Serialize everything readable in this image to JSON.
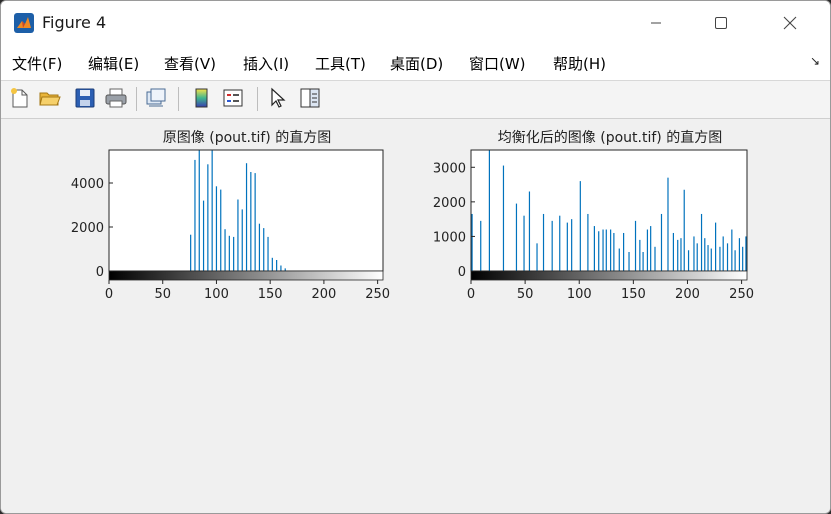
{
  "window": {
    "title": "Figure 4"
  },
  "menu": {
    "items": [
      "文件(F)",
      "编辑(E)",
      "查看(V)",
      "插入(I)",
      "工具(T)",
      "桌面(D)",
      "窗口(W)",
      "帮助(H)"
    ],
    "overflow_icon": "menu-dock-arrow-icon"
  },
  "toolbar": {
    "icons": [
      "new-figure-icon",
      "open-file-icon",
      "save-icon",
      "print-icon",
      "link-plot-icon",
      "insert-colorbar-icon",
      "insert-legend-icon",
      "pointer-icon",
      "property-inspector-icon"
    ]
  },
  "chart_data": [
    {
      "type": "bar",
      "title": "原图像 (pout.tif) 的直方图",
      "xlim": [
        0,
        255
      ],
      "ylim": [
        0,
        5500
      ],
      "xticks": [
        0,
        50,
        100,
        150,
        200,
        250
      ],
      "yticks": [
        0,
        2000,
        4000
      ],
      "xlabel": "",
      "ylabel": "",
      "colorbar": "grayscale",
      "bar_color": "#0072bd",
      "x": [
        76,
        80,
        84,
        88,
        92,
        96,
        100,
        104,
        108,
        112,
        116,
        120,
        124,
        128,
        132,
        136,
        140,
        144,
        148,
        152,
        156,
        160,
        164
      ],
      "values": [
        1650,
        5050,
        5600,
        3200,
        4850,
        5550,
        3850,
        3700,
        1900,
        1600,
        1550,
        3250,
        2800,
        4900,
        4500,
        4450,
        2150,
        1950,
        1550,
        600,
        500,
        250,
        120
      ]
    },
    {
      "type": "bar",
      "title": "均衡化后的图像 (pout.tif) 的直方图",
      "xlim": [
        0,
        255
      ],
      "ylim": [
        0,
        3500
      ],
      "xticks": [
        0,
        50,
        100,
        150,
        200,
        250
      ],
      "yticks": [
        0,
        1000,
        2000,
        3000
      ],
      "xlabel": "",
      "ylabel": "",
      "colorbar": "grayscale",
      "bar_color": "#0072bd",
      "x": [
        1,
        9,
        17,
        30,
        42,
        49,
        54,
        61,
        67,
        75,
        82,
        89,
        93,
        101,
        108,
        114,
        118,
        122,
        125,
        129,
        132,
        137,
        141,
        146,
        152,
        156,
        159,
        163,
        166,
        170,
        176,
        182,
        187,
        191,
        194,
        197,
        201,
        206,
        209,
        213,
        216,
        219,
        222,
        226,
        230,
        233,
        237,
        241,
        244,
        248,
        251,
        254
      ],
      "values": [
        1650,
        1450,
        3500,
        3050,
        1950,
        1600,
        2300,
        800,
        1650,
        1450,
        1600,
        1400,
        1500,
        2600,
        1650,
        1300,
        1150,
        1200,
        1200,
        1200,
        1100,
        650,
        1100,
        550,
        1450,
        900,
        550,
        1200,
        1300,
        700,
        1650,
        2700,
        1100,
        900,
        950,
        2350,
        600,
        1000,
        800,
        1650,
        950,
        750,
        650,
        1400,
        700,
        1000,
        800,
        1200,
        600,
        950,
        700,
        1000
      ]
    }
  ]
}
